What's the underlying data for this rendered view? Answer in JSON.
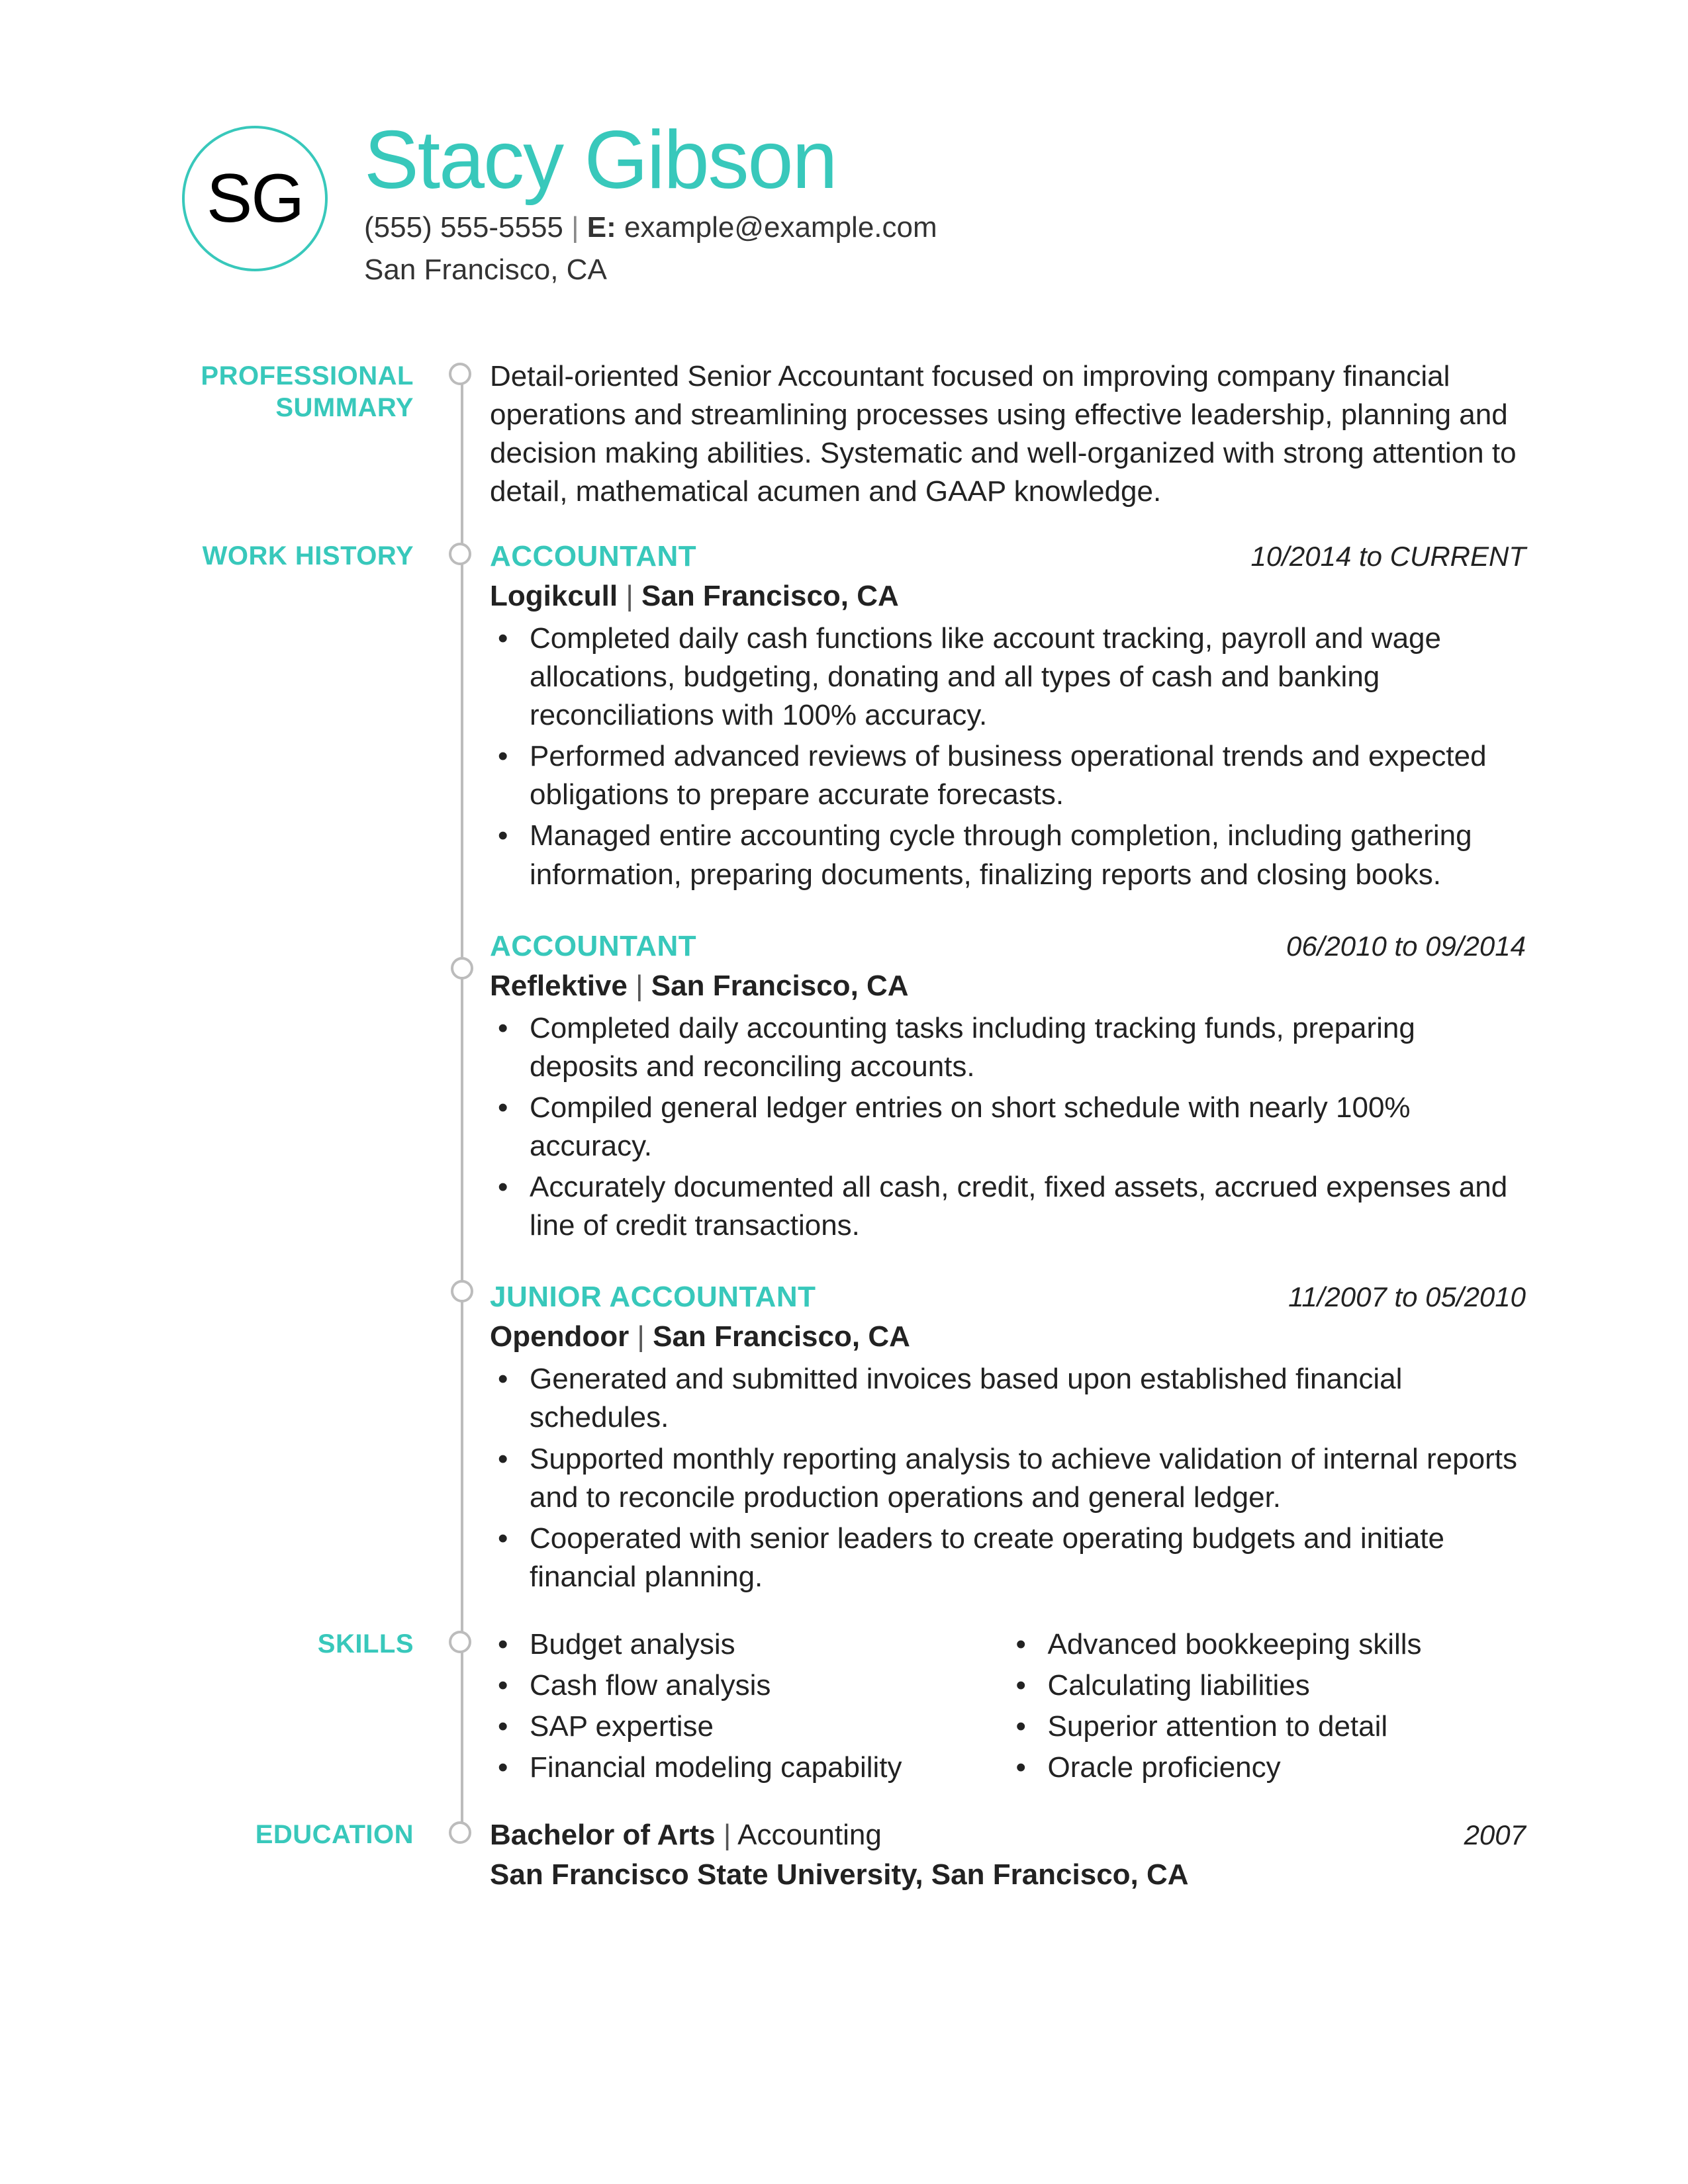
{
  "colors": {
    "accent": "#38c8bb"
  },
  "header": {
    "initials": "SG",
    "name": "Stacy Gibson",
    "phone": "(555) 555-5555",
    "email_label": "E:",
    "email": "example@example.com",
    "location": "San Francisco, CA"
  },
  "sections": {
    "summary_label_l1": "PROFESSIONAL",
    "summary_label_l2": "SUMMARY",
    "work_label": "WORK HISTORY",
    "skills_label": "SKILLS",
    "education_label": "EDUCATION"
  },
  "summary": "Detail-oriented Senior Accountant focused on improving company financial operations and streamlining processes using effective leadership, planning and decision making abilities. Systematic and well-organized with strong attention to detail, mathematical acumen and GAAP knowledge.",
  "jobs": [
    {
      "title": "ACCOUNTANT",
      "dates": "10/2014 to CURRENT",
      "company": "Logikcull",
      "location": "San Francisco, CA",
      "bullets": [
        "Completed daily cash functions like account tracking, payroll and wage allocations, budgeting, donating and all types of cash and banking reconciliations with 100% accuracy.",
        "Performed advanced reviews of business operational trends and expected obligations to prepare accurate forecasts.",
        "Managed entire accounting cycle through completion, including gathering information, preparing documents, finalizing reports and closing books."
      ]
    },
    {
      "title": "ACCOUNTANT",
      "dates": "06/2010 to 09/2014",
      "company": "Reflektive",
      "location": "San Francisco, CA",
      "bullets": [
        "Completed daily accounting tasks including tracking funds, preparing deposits and reconciling accounts.",
        "Compiled general ledger entries on short schedule with nearly 100% accuracy.",
        "Accurately documented all cash, credit, fixed assets, accrued expenses and line of credit transactions."
      ]
    },
    {
      "title": "JUNIOR ACCOUNTANT",
      "dates": "11/2007 to 05/2010",
      "company": "Opendoor",
      "location": "San Francisco, CA",
      "bullets": [
        "Generated and submitted invoices based upon established financial schedules.",
        "Supported monthly reporting analysis to achieve validation of internal reports and to reconcile production operations and general ledger.",
        "Cooperated with senior leaders to create operating budgets and initiate financial planning."
      ]
    }
  ],
  "skills": {
    "col1": [
      "Budget analysis",
      "Cash flow analysis",
      "SAP expertise",
      "Financial modeling capability"
    ],
    "col2": [
      "Advanced bookkeeping skills",
      "Calculating liabilities",
      "Superior attention to detail",
      "Oracle proficiency"
    ]
  },
  "education": {
    "degree": "Bachelor of Arts",
    "field": "Accounting",
    "year": "2007",
    "school": "San Francisco State University, San Francisco, CA"
  }
}
